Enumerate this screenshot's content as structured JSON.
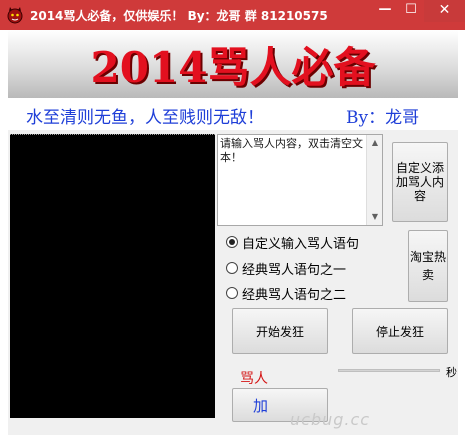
{
  "window": {
    "title": "2014骂人必备，仅供娱乐！ By：龙哥  群 81210575",
    "minimize_glyph": "—",
    "maximize_glyph": "☐",
    "close_glyph": "✕",
    "title_bar_color": "#cf3a3a"
  },
  "banner": {
    "title": "2014骂人必备",
    "title_color": "#e3101f"
  },
  "slogan": {
    "text": "水至清则无鱼，人至贱则无敌！",
    "author": "By：龙哥",
    "color": "#1f3fd8"
  },
  "input": {
    "placeholder": "请输入骂人内容，双击清空文本！"
  },
  "buttons": {
    "custom_add": "自定义添加骂人内容",
    "taobao": "淘宝热卖",
    "start": "开始发狂",
    "stop": "停止发狂",
    "add_partial": "加"
  },
  "radio_options": [
    {
      "label": "自定义输入骂人语句",
      "checked": true
    },
    {
      "label": "经典骂人语句之一",
      "checked": false
    },
    {
      "label": "经典骂人语句之二",
      "checked": false
    }
  ],
  "speed": {
    "label_partial": "骂人",
    "unit_partial": "秒"
  },
  "watermark": "ucbug.cc",
  "icons": {
    "app_icon": "devil-icon",
    "scroll_up": "chevron-up-icon",
    "scroll_down": "chevron-down-icon"
  }
}
